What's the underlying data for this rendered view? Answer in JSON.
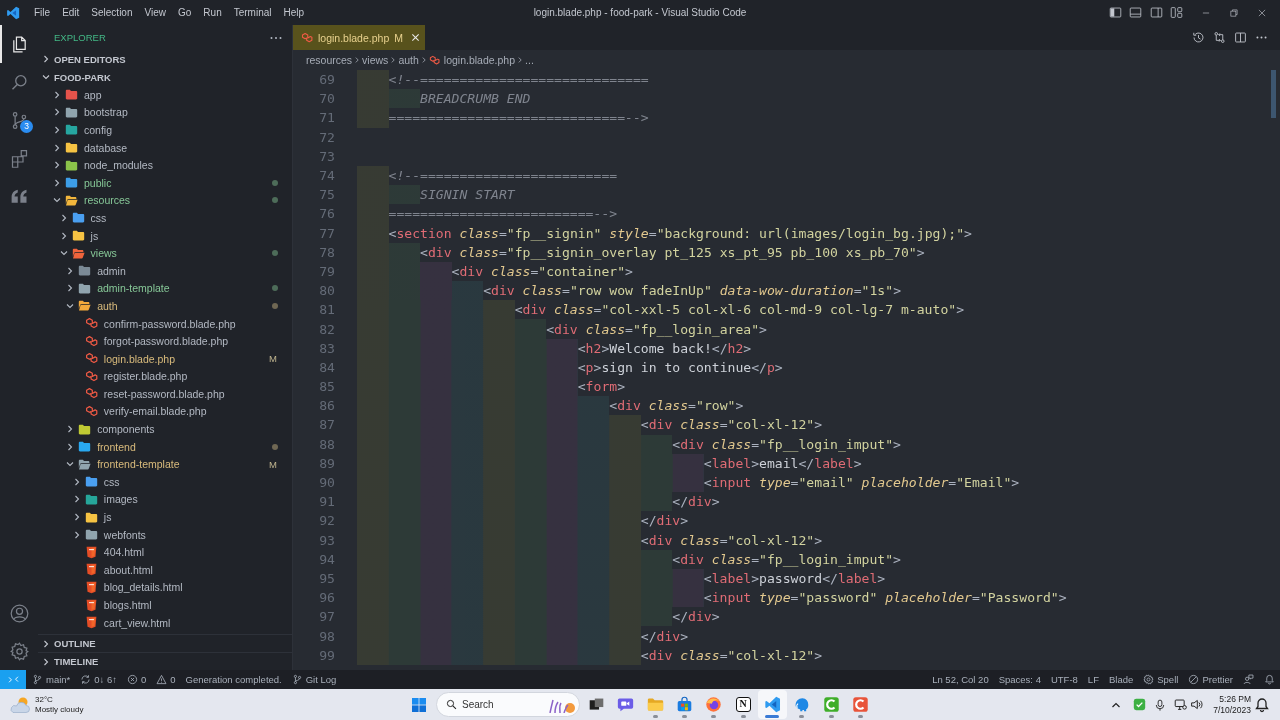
{
  "title_bar": {
    "menu": [
      "File",
      "Edit",
      "Selection",
      "View",
      "Go",
      "Run",
      "Terminal",
      "Help"
    ],
    "title": "login.blade.php - food-park - Visual Studio Code"
  },
  "activity_bar": {
    "top": [
      {
        "kind": "explorer",
        "selected": true
      },
      {
        "kind": "search",
        "selected": false
      },
      {
        "kind": "source-control",
        "selected": false,
        "badge": "3"
      },
      {
        "kind": "extensions",
        "selected": false
      },
      {
        "kind": "quote",
        "selected": false
      }
    ],
    "bottom": [
      {
        "kind": "account"
      },
      {
        "kind": "settings"
      }
    ]
  },
  "sidebar": {
    "title": "EXPLORER",
    "sections": [
      {
        "title": "OPEN EDITORS",
        "expanded": false
      },
      {
        "title": "FOOD-PARK",
        "expanded": true,
        "tree": [
          {
            "name": "app",
            "kind": "folder",
            "color": "#e5534b",
            "expanded": false,
            "untracked": false,
            "modified": false,
            "dot": false
          },
          {
            "name": "bootstrap",
            "kind": "folder",
            "color": "#90a4ae",
            "expanded": false,
            "untracked": false,
            "modified": false,
            "dot": false
          },
          {
            "name": "config",
            "kind": "folder",
            "color": "#26a6a0",
            "expanded": false,
            "untracked": false,
            "modified": false,
            "dot": false
          },
          {
            "name": "database",
            "kind": "folder",
            "color": "#f6c343",
            "expanded": false,
            "untracked": false,
            "modified": false,
            "dot": false
          },
          {
            "name": "node_modules",
            "kind": "folder",
            "color": "#8bc34a",
            "expanded": false,
            "untracked": false,
            "modified": false,
            "dot": false
          },
          {
            "name": "public",
            "kind": "folder",
            "color": "#3d9ee8",
            "expanded": false,
            "untracked": true,
            "modified": false,
            "dot": true
          },
          {
            "name": "resources",
            "kind": "folder",
            "color": "#f2b63c",
            "expanded": true,
            "untracked": true,
            "modified": false,
            "dot": true,
            "children": [
              {
                "name": "css",
                "kind": "folder",
                "color": "#4a9ff0",
                "expanded": false,
                "untracked": false,
                "modified": false,
                "dot": false
              },
              {
                "name": "js",
                "kind": "folder",
                "color": "#f6c343",
                "expanded": false,
                "untracked": false,
                "modified": false,
                "dot": false
              },
              {
                "name": "views",
                "kind": "folder",
                "color": "#f0643c",
                "expanded": true,
                "untracked": true,
                "modified": false,
                "dot": true,
                "children": [
                  {
                    "name": "admin",
                    "kind": "folder",
                    "color": "#7b8a96",
                    "expanded": false,
                    "untracked": false,
                    "modified": false,
                    "dot": false
                  },
                  {
                    "name": "admin-template",
                    "kind": "folder",
                    "color": "#90a4ae",
                    "expanded": false,
                    "untracked": true,
                    "modified": false,
                    "dot": true
                  },
                  {
                    "name": "auth",
                    "kind": "folder",
                    "color": "#f2a93b",
                    "expanded": true,
                    "untracked": false,
                    "modified": true,
                    "dot": true,
                    "children": [
                      {
                        "name": "confirm-password.blade.php",
                        "kind": "blade",
                        "untracked": false,
                        "modified": false,
                        "dot": false
                      },
                      {
                        "name": "forgot-password.blade.php",
                        "kind": "blade",
                        "untracked": false,
                        "modified": false,
                        "dot": false
                      },
                      {
                        "name": "login.blade.php",
                        "kind": "blade",
                        "untracked": false,
                        "modified": true,
                        "dot": false,
                        "badge": "M"
                      },
                      {
                        "name": "register.blade.php",
                        "kind": "blade",
                        "untracked": false,
                        "modified": false,
                        "dot": false
                      },
                      {
                        "name": "reset-password.blade.php",
                        "kind": "blade",
                        "untracked": false,
                        "modified": false,
                        "dot": false
                      },
                      {
                        "name": "verify-email.blade.php",
                        "kind": "blade",
                        "untracked": false,
                        "modified": false,
                        "dot": false
                      }
                    ]
                  },
                  {
                    "name": "components",
                    "kind": "folder",
                    "color": "#c0ca33",
                    "expanded": false,
                    "untracked": false,
                    "modified": false,
                    "dot": false
                  },
                  {
                    "name": "frontend",
                    "kind": "folder",
                    "color": "#29a8f0",
                    "expanded": false,
                    "untracked": false,
                    "modified": true,
                    "dot": true
                  },
                  {
                    "name": "frontend-template",
                    "kind": "folder",
                    "color": "#90a4ae",
                    "expanded": true,
                    "untracked": false,
                    "modified": true,
                    "dot": false,
                    "badge": "M",
                    "children": [
                      {
                        "name": "css",
                        "kind": "folder",
                        "color": "#4a9ff0",
                        "expanded": false,
                        "untracked": false,
                        "modified": false,
                        "dot": false
                      },
                      {
                        "name": "images",
                        "kind": "folder",
                        "color": "#26a69a",
                        "expanded": false,
                        "untracked": false,
                        "modified": false,
                        "dot": false
                      },
                      {
                        "name": "js",
                        "kind": "folder",
                        "color": "#f6c343",
                        "expanded": false,
                        "untracked": false,
                        "modified": false,
                        "dot": false
                      },
                      {
                        "name": "webfonts",
                        "kind": "folder",
                        "color": "#90a4ae",
                        "expanded": false,
                        "untracked": false,
                        "modified": false,
                        "dot": false
                      },
                      {
                        "name": "404.html",
                        "kind": "html",
                        "untracked": false,
                        "modified": false,
                        "dot": false
                      },
                      {
                        "name": "about.html",
                        "kind": "html",
                        "untracked": false,
                        "modified": false,
                        "dot": false
                      },
                      {
                        "name": "blog_details.html",
                        "kind": "html",
                        "untracked": false,
                        "modified": false,
                        "dot": false
                      },
                      {
                        "name": "blogs.html",
                        "kind": "html",
                        "untracked": false,
                        "modified": false,
                        "dot": false
                      },
                      {
                        "name": "cart_view.html",
                        "kind": "html",
                        "untracked": false,
                        "modified": false,
                        "dot": false
                      }
                    ]
                  }
                ]
              }
            ]
          }
        ]
      },
      {
        "title": "OUTLINE",
        "expanded": false
      },
      {
        "title": "TIMELINE",
        "expanded": false
      }
    ]
  },
  "editor": {
    "tabs": [
      {
        "label": "login.blade.php",
        "badge": "M",
        "selected": true
      }
    ],
    "breadcrumb": [
      {
        "label": "resources",
        "kind": "folder"
      },
      {
        "label": "views",
        "kind": "folder"
      },
      {
        "label": "auth",
        "kind": "folder"
      },
      {
        "label": "login.blade.php",
        "kind": "blade"
      },
      {
        "label": "...",
        "kind": "symbol"
      }
    ],
    "lines": [
      {
        "number": "69",
        "text": "    <!--============================="
      },
      {
        "number": "70",
        "text": "        BREADCRUMB END"
      },
      {
        "number": "71",
        "text": "    ==============================-->"
      },
      {
        "number": "72"
      },
      {
        "number": "73"
      },
      {
        "number": "74",
        "text": "    <!--========================="
      },
      {
        "number": "75",
        "text": "        SIGNIN START"
      },
      {
        "number": "76",
        "text": "    ==========================-->"
      },
      {
        "number": "77",
        "text": "    <section class=\"fp__signin\" style=\"background: url(images/login_bg.jpg);\">"
      },
      {
        "number": "78",
        "text": "        <div class=\"fp__signin_overlay pt_125 xs_pt_95 pb_100 xs_pb_70\">"
      },
      {
        "number": "79",
        "text": "            <div class=\"container\">"
      },
      {
        "number": "80",
        "text": "                <div class=\"row wow fadeInUp\" data-wow-duration=\"1s\">"
      },
      {
        "number": "81",
        "text": "                    <div class=\"col-xxl-5 col-xl-6 col-md-9 col-lg-7 m-auto\">"
      },
      {
        "number": "82",
        "text": "                        <div class=\"fp__login_area\">"
      },
      {
        "number": "83",
        "text": "                            <h2>Welcome back!</h2>"
      },
      {
        "number": "84",
        "text": "                            <p>sign in to continue</p>"
      },
      {
        "number": "85",
        "text": "                            <form>"
      },
      {
        "number": "86",
        "text": "                                <div class=\"row\">"
      },
      {
        "number": "87",
        "text": "                                    <div class=\"col-xl-12\">"
      },
      {
        "number": "88",
        "text": "                                        <div class=\"fp__login_imput\">"
      },
      {
        "number": "89",
        "text": "                                            <label>email</label>"
      },
      {
        "number": "90",
        "text": "                                            <input type=\"email\" placeholder=\"Email\">"
      },
      {
        "number": "91",
        "text": "                                        </div>"
      },
      {
        "number": "92",
        "text": "                                    </div>"
      },
      {
        "number": "93",
        "text": "                                    <div class=\"col-xl-12\">"
      },
      {
        "number": "94",
        "text": "                                        <div class=\"fp__login_imput\">"
      },
      {
        "number": "95",
        "text": "                                            <label>password</label>"
      },
      {
        "number": "96",
        "text": "                                            <input type=\"password\" placeholder=\"Password\">"
      },
      {
        "number": "97",
        "text": "                                        </div>"
      },
      {
        "number": "98",
        "text": "                                    </div>"
      },
      {
        "number": "99",
        "text": "                                    <div class=\"col-xl-12\">"
      }
    ]
  },
  "status_bar": {
    "left": [
      {
        "kind": "remote"
      },
      {
        "kind": "branch",
        "label": "main*"
      },
      {
        "kind": "sync",
        "label": "0↓ 6↑"
      },
      {
        "kind": "errors",
        "label": "0"
      },
      {
        "kind": "warnings",
        "label": "0"
      },
      {
        "kind": "message",
        "label": "Generation completed."
      },
      {
        "kind": "git-log",
        "label": "Git Log"
      }
    ],
    "right": [
      {
        "kind": "text",
        "label": "Ln 52, Col 20"
      },
      {
        "kind": "text",
        "label": "Spaces: 4"
      },
      {
        "kind": "text",
        "label": "UTF-8"
      },
      {
        "kind": "text",
        "label": "LF"
      },
      {
        "kind": "text",
        "label": "Blade"
      },
      {
        "kind": "spell",
        "label": "Spell"
      },
      {
        "kind": "prettier",
        "label": "Prettier"
      },
      {
        "kind": "feedback"
      },
      {
        "kind": "bell"
      }
    ]
  },
  "taskbar": {
    "weather": {
      "temperature": "32°C",
      "condition": "Mostly cloudy"
    },
    "search": {
      "placeholder": "Search"
    },
    "apps": [
      {
        "kind": "task-view",
        "running": false,
        "active": false
      },
      {
        "kind": "chat",
        "running": false,
        "active": false
      },
      {
        "kind": "file-explorer",
        "running": true,
        "active": false
      },
      {
        "kind": "store",
        "running": true,
        "active": false
      },
      {
        "kind": "firefox",
        "running": true,
        "active": false
      },
      {
        "kind": "letter-tile",
        "glyph": "N",
        "running": true,
        "active": false
      },
      {
        "kind": "vscode",
        "running": true,
        "active": true
      },
      {
        "kind": "elephant",
        "running": true,
        "active": false
      },
      {
        "kind": "green-tile",
        "running": true,
        "active": false
      },
      {
        "kind": "orange-tile",
        "running": true,
        "active": false
      }
    ],
    "clock": {
      "time": "5:26 PM",
      "date": "7/10/2023"
    }
  }
}
